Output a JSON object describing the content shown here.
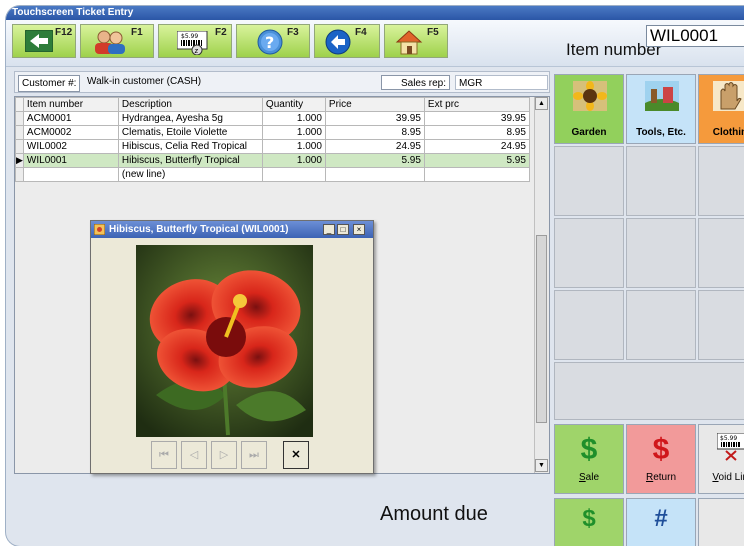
{
  "window": {
    "title": "Touchscreen Ticket Entry"
  },
  "toolbar": {
    "buttons": [
      {
        "key": "F12",
        "icon": "back-arrow-icon"
      },
      {
        "key": "F1",
        "icon": "customers-icon"
      },
      {
        "key": "F2",
        "icon": "barcode-price-icon",
        "price_text": "$5.99"
      },
      {
        "key": "F3",
        "icon": "help-icon",
        "glyph": "?"
      },
      {
        "key": "F4",
        "icon": "previous-arrow-icon"
      },
      {
        "key": "F5",
        "icon": "home-icon"
      }
    ]
  },
  "item_number": {
    "label": "Item number",
    "value": "WIL0001"
  },
  "customer": {
    "label": "Customer #:",
    "value": "Walk-in customer  (CASH)"
  },
  "sales_rep": {
    "label": "Sales rep:",
    "value": "MGR"
  },
  "grid": {
    "columns": [
      "Item number",
      "Description",
      "Quantity",
      "Price",
      "Ext prc"
    ],
    "rows": [
      {
        "item": "ACM0001",
        "description": "Hydrangea, Ayesha  5g",
        "qty": "1.000",
        "price": "39.95",
        "ext": "39.95"
      },
      {
        "item": "ACM0002",
        "description": "Clematis, Etoile Violette",
        "qty": "1.000",
        "price": "8.95",
        "ext": "8.95"
      },
      {
        "item": "WIL0002",
        "description": "Hibiscus, Celia Red Tropical",
        "qty": "1.000",
        "price": "24.95",
        "ext": "24.95"
      },
      {
        "item": "WIL0001",
        "description": "Hibiscus, Butterfly Tropical",
        "qty": "1.000",
        "price": "5.95",
        "ext": "5.95",
        "current_marker": "▶"
      }
    ],
    "new_line": "(new line)"
  },
  "popup": {
    "title": "Hibiscus, Butterfly Tropical (WIL0001)",
    "nav": {
      "first": "⏮",
      "prev": "◁",
      "next": "▷",
      "last": "⏭",
      "close": "✕"
    }
  },
  "amount_due_label": "Amount due",
  "categories": [
    {
      "label": "Garden",
      "color": "#92d05c",
      "icon": "sunflower-icon"
    },
    {
      "label": "Tools, Etc.",
      "color": "#c5e3f8",
      "icon": "tools-icon"
    },
    {
      "label": "Clothing",
      "color": "#f59a3c",
      "icon": "glove-icon"
    }
  ],
  "actions": [
    {
      "label": "Sale",
      "underline": "S",
      "rest": "ale",
      "symbol": "$",
      "color": "#9fd46a",
      "symbol_color": "#1f8f2a"
    },
    {
      "label": "Return",
      "underline": "R",
      "rest": "eturn",
      "symbol": "$",
      "color": "#f29a9a",
      "symbol_color": "#d0161b"
    },
    {
      "label": "Void Line",
      "underline": "V",
      "rest": "oid Line",
      "symbol": "$5.99",
      "color": "#e8e8e8",
      "symbol_color": "#222"
    }
  ],
  "bottom_partial": {
    "sym1": "$",
    "sym2": "#"
  }
}
